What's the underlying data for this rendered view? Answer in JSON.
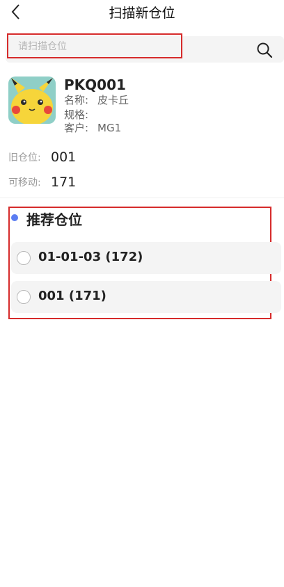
{
  "nav": {
    "title": "扫描新仓位",
    "back_icon": "chevron-left-icon"
  },
  "search": {
    "placeholder": "请扫描仓位",
    "value": "",
    "icon": "search-icon"
  },
  "product": {
    "code": "PKQ001",
    "name_label": "名称:",
    "name_value": "皮卡丘",
    "spec_label": "规格:",
    "spec_value": "",
    "customer_label": "客户:",
    "customer_value": "MG1",
    "image": "pikachu-thumbnail"
  },
  "info": {
    "old_location_label": "旧仓位:",
    "old_location_value": "001",
    "movable_label": "可移动:",
    "movable_value": "171"
  },
  "recommend": {
    "title": "推荐仓位",
    "options": [
      {
        "label": "01-01-03 (172)"
      },
      {
        "label": "001 (171)"
      }
    ]
  },
  "colors": {
    "highlight_border": "#d62b2b",
    "accent_dot": "#5b7df2",
    "option_bg": "#f4f4f4"
  }
}
